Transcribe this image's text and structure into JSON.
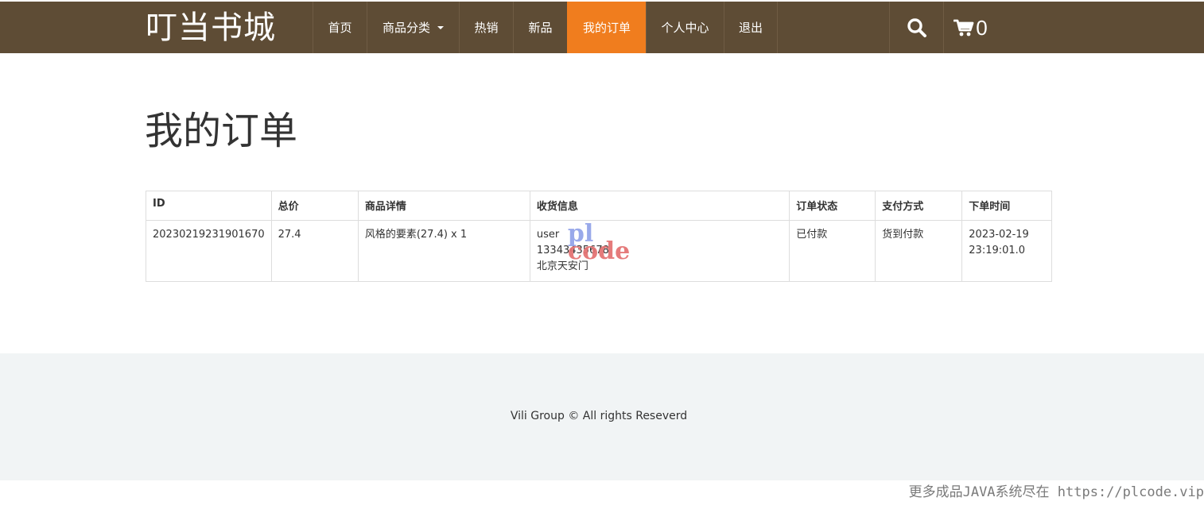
{
  "brand": "叮当书城",
  "nav": {
    "items": [
      {
        "label": "首页",
        "width": 68
      },
      {
        "label": "商品分类",
        "width": 116,
        "has_caret": true
      },
      {
        "label": "热销",
        "width": 68
      },
      {
        "label": "新品",
        "width": 68
      },
      {
        "label": "我的订单",
        "width": 99,
        "active": true
      },
      {
        "label": "个人中心",
        "width": 98
      },
      {
        "label": "退出",
        "width": 68
      }
    ]
  },
  "cart": {
    "count": "0"
  },
  "page_title": "我的订单",
  "table": {
    "headers": [
      "ID",
      "总价",
      "商品详情",
      "收货信息",
      "订单状态",
      "支付方式",
      "下单时间"
    ],
    "rows": [
      {
        "id": "20230219231901670",
        "total": "27.4",
        "detail": "风格的要素(27.4) x 1",
        "receiver": "user",
        "phone": "13343435678",
        "address": "北京天安门",
        "status": "已付款",
        "payment": "货到付款",
        "date": "2023-02-19",
        "time": "23:19:01.0"
      }
    ]
  },
  "watermark": {
    "line1": "pl",
    "line2": "code"
  },
  "footer": "Vili Group © All rights Reseverd",
  "bottom_note": "更多成品JAVA系统尽在 https://plcode.vip",
  "colors": {
    "nav_bg": "#5e4c35",
    "active": "#f07d1e",
    "status_paid": "#d9241e",
    "footer_bg": "#f1f4f5"
  }
}
